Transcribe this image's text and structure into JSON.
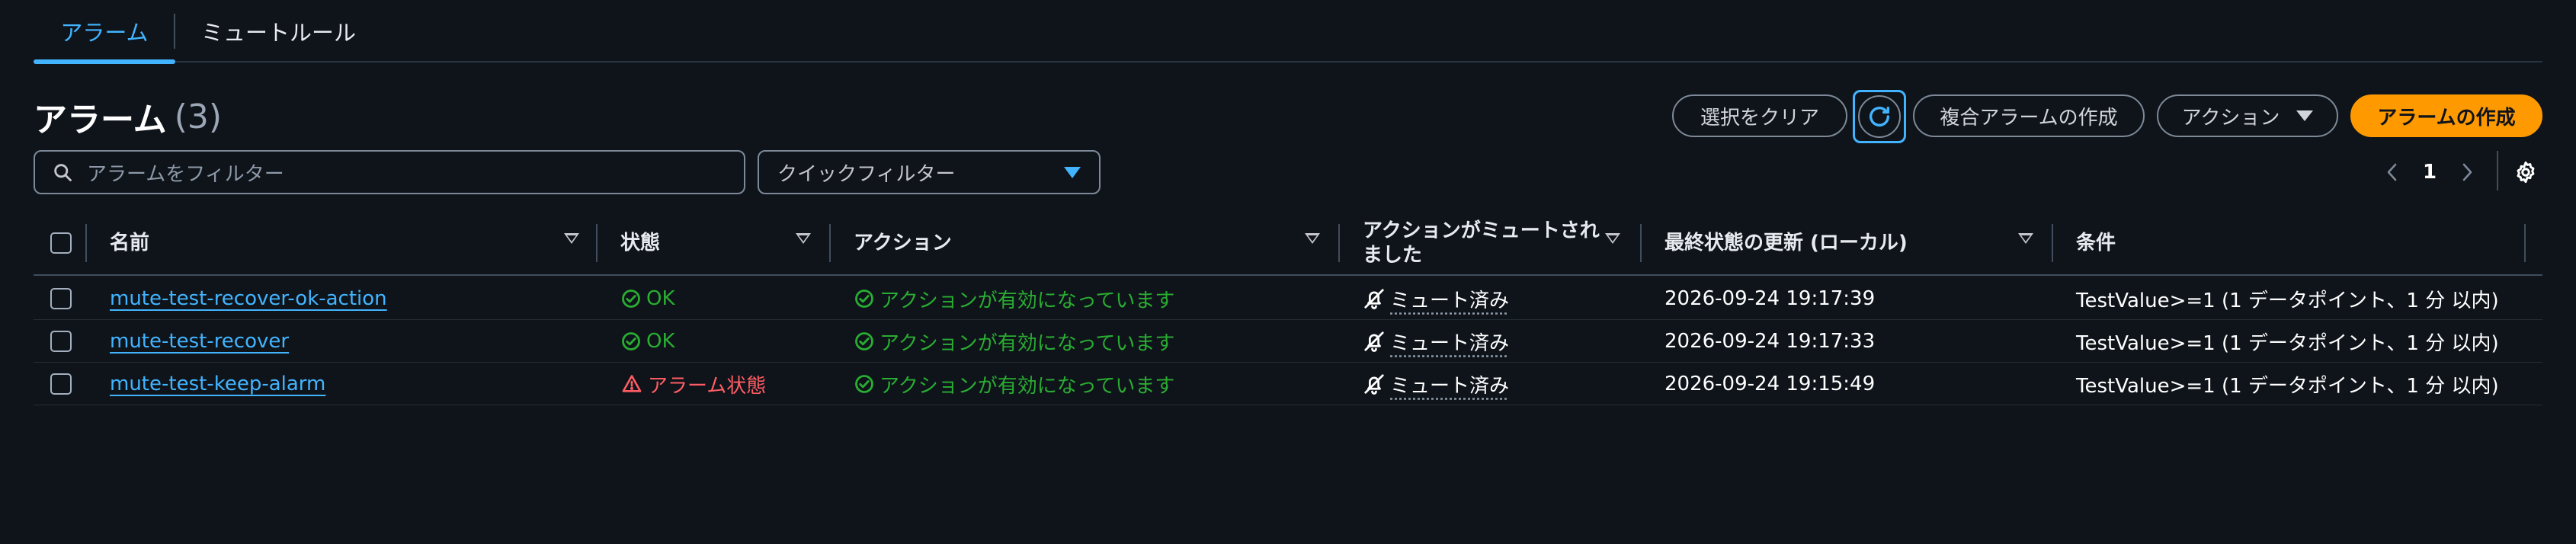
{
  "tabs": [
    {
      "label": "アラーム",
      "active": true
    },
    {
      "label": "ミュートルール",
      "active": false
    }
  ],
  "header": {
    "title": "アラーム",
    "count": "(3)"
  },
  "toolbar": {
    "clear_label": "選択をクリア",
    "composite_label": "複合アラームの作成",
    "actions_label": "アクション",
    "create_label": "アラームの作成"
  },
  "filter": {
    "search_placeholder": "アラームをフィルター",
    "quick_filter_placeholder": "クイックフィルター"
  },
  "pagination": {
    "current_page": "1"
  },
  "table": {
    "columns": {
      "name": "名前",
      "state": "状態",
      "actions": "アクション",
      "muted_line1": "アクションがミュートされ",
      "muted_line2": "ました",
      "updated": "最終状態の更新 (ローカル)",
      "conditions": "条件"
    },
    "rows": [
      {
        "name": "mute-test-recover-ok-action",
        "state": "OK",
        "state_type": "ok",
        "actions": "アクションが有効になっています",
        "muted": "ミュート済み",
        "updated": "2026-09-24 19:17:39",
        "conditions": "TestValue>=1 (1 データポイント、1 分 以内)"
      },
      {
        "name": "mute-test-recover",
        "state": "OK",
        "state_type": "ok",
        "actions": "アクションが有効になっています",
        "muted": "ミュート済み",
        "updated": "2026-09-24 19:17:33",
        "conditions": "TestValue>=1 (1 データポイント、1 分 以内)"
      },
      {
        "name": "mute-test-keep-alarm",
        "state": "アラーム状態",
        "state_type": "alarm",
        "actions": "アクションが有効になっています",
        "muted": "ミュート済み",
        "updated": "2026-09-24 19:15:49",
        "conditions": "TestValue>=1 (1 データポイント、1 分 以内)"
      }
    ]
  },
  "colors": {
    "background": "#0f141a",
    "accent": "#42b4ff",
    "primary_button": "#ff9900",
    "ok": "#29ad32",
    "alarm": "#ff5d64"
  }
}
